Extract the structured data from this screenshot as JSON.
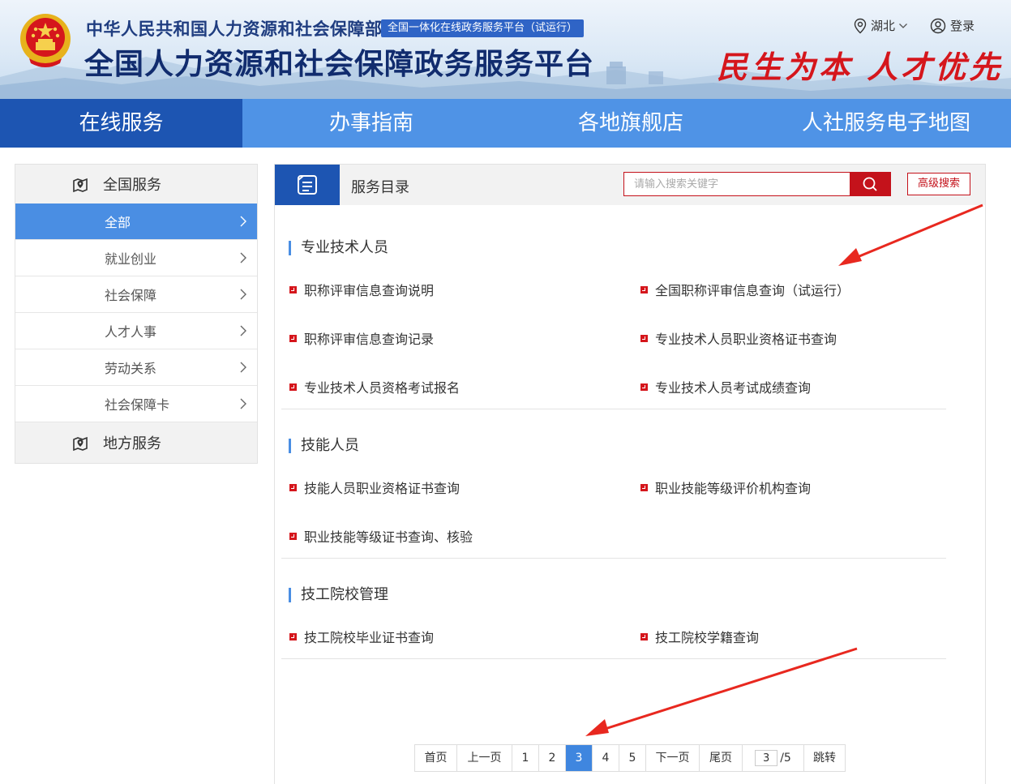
{
  "header": {
    "ministry_name": "中华人民共和国人力资源和社会保障部",
    "platform_badge": "全国一体化在线政务服务平台（试运行）",
    "site_title": "全国人力资源和社会保障政务服务平台",
    "slogan": "民生为本 人才优先",
    "region": "湖北",
    "login": "登录"
  },
  "nav": {
    "items": [
      {
        "label": "在线服务",
        "active": true
      },
      {
        "label": "办事指南",
        "active": false
      },
      {
        "label": "各地旗舰店",
        "active": false
      },
      {
        "label": "人社服务电子地图",
        "active": false
      }
    ]
  },
  "sidebar": {
    "national_header": "全国服务",
    "items": [
      {
        "label": "全部",
        "active": true
      },
      {
        "label": "就业创业",
        "active": false
      },
      {
        "label": "社会保障",
        "active": false
      },
      {
        "label": "人才人事",
        "active": false
      },
      {
        "label": "劳动关系",
        "active": false
      },
      {
        "label": "社会保障卡",
        "active": false
      }
    ],
    "local_header": "地方服务"
  },
  "panel": {
    "title": "服务目录",
    "search_placeholder": "请输入搜索关键字",
    "advanced_search": "高级搜索",
    "sections": [
      {
        "title": "专业技术人员",
        "links": [
          "职称评审信息查询说明",
          "全国职称评审信息查询（试运行）",
          "职称评审信息查询记录",
          "专业技术人员职业资格证书查询",
          "专业技术人员资格考试报名",
          "专业技术人员考试成绩查询"
        ]
      },
      {
        "title": "技能人员",
        "links": [
          "技能人员职业资格证书查询",
          "职业技能等级评价机构查询",
          "职业技能等级证书查询、核验"
        ]
      },
      {
        "title": "技工院校管理",
        "links": [
          "技工院校毕业证书查询",
          "技工院校学籍查询"
        ]
      }
    ]
  },
  "pagination": {
    "first": "首页",
    "prev": "上一页",
    "pages": [
      "1",
      "2",
      "3",
      "4",
      "5"
    ],
    "current": "3",
    "next": "下一页",
    "last": "尾页",
    "jump_value": "3",
    "total": "/5",
    "jump": "跳转"
  },
  "colors": {
    "nav_blue": "#4f93e6",
    "nav_active": "#1d55b2",
    "accent_red": "#c4121b",
    "sidebar_active": "#4a8ee3",
    "annotation_arrow": "#e8281f"
  }
}
